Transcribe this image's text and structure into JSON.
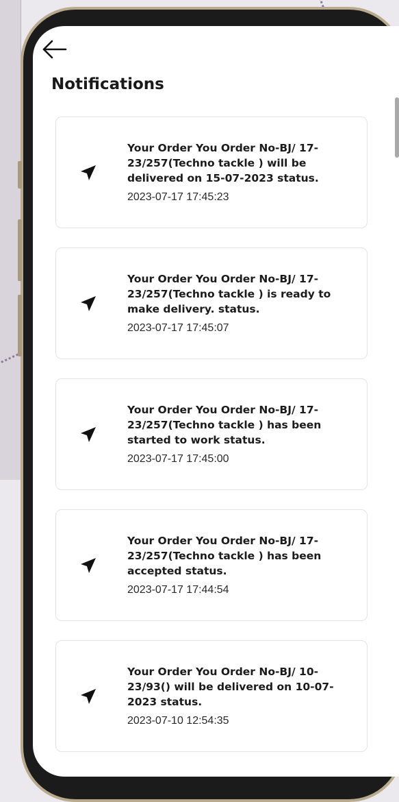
{
  "header": {
    "title": "Notifications",
    "back_icon": "arrow-left-icon"
  },
  "notifications": [
    {
      "icon": "send-icon",
      "message": "Your Order You Order No-BJ/ 17-23/257(Techno tackle ) will be delivered on 15-07-2023 status.",
      "time": "2023-07-17 17:45:23"
    },
    {
      "icon": "send-icon",
      "message": "Your Order You Order No-BJ/ 17-23/257(Techno tackle ) is ready to make delivery. status.",
      "time": "2023-07-17 17:45:07"
    },
    {
      "icon": "send-icon",
      "message": "Your Order You Order No-BJ/ 17-23/257(Techno tackle ) has been started to work status.",
      "time": "2023-07-17 17:45:00"
    },
    {
      "icon": "send-icon",
      "message": "Your Order You Order No-BJ/ 17-23/257(Techno tackle ) has been accepted status.",
      "time": "2023-07-17 17:44:54"
    },
    {
      "icon": "send-icon",
      "message": "Your Order You Order No-BJ/ 10-23/93() will be delivered on 10-07-2023 status.",
      "time": "2023-07-10 12:54:35"
    }
  ]
}
